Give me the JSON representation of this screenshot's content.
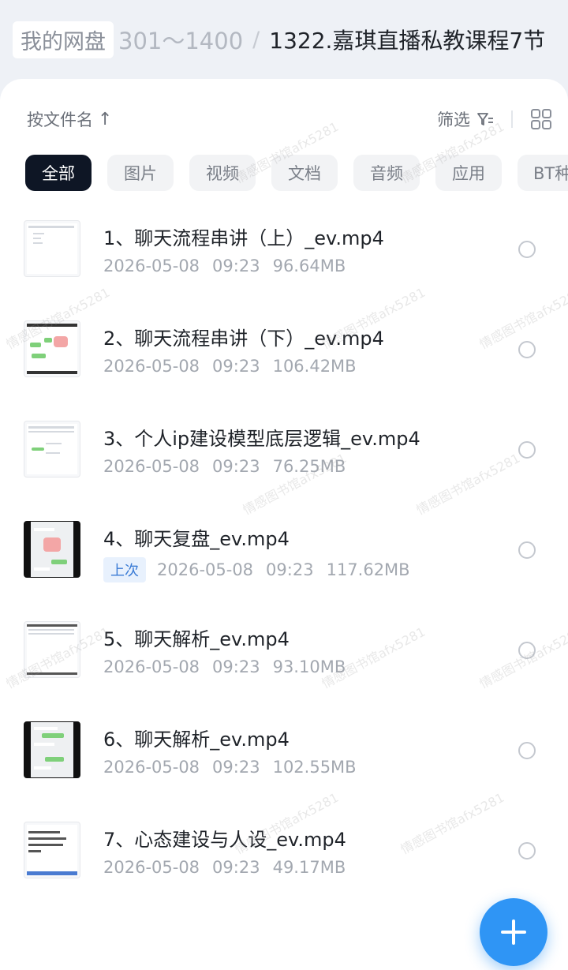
{
  "breadcrumb": {
    "root": "我的网盘",
    "parent": "301～1400",
    "separator": "/",
    "current": "1322.嘉琪直播私教课程7节"
  },
  "toolbar": {
    "sort_label": "按文件名",
    "sort_arrow": "↑",
    "filter_label": "筛选",
    "filter_icon": "filter-icon",
    "view_icon": "grid-view-icon"
  },
  "categories": [
    "全部",
    "图片",
    "视频",
    "文档",
    "音频",
    "应用",
    "BT种子"
  ],
  "active_category": "全部",
  "files": [
    {
      "name": "1、聊天流程串讲（上）_ev.mp4",
      "date": "2026-05-08",
      "time": "09:23",
      "size": "96.64MB",
      "badge": ""
    },
    {
      "name": "2、聊天流程串讲（下）_ev.mp4",
      "date": "2026-05-08",
      "time": "09:23",
      "size": "106.42MB",
      "badge": ""
    },
    {
      "name": "3、个人ip建设模型底层逻辑_ev.mp4",
      "date": "2026-05-08",
      "time": "09:23",
      "size": "76.25MB",
      "badge": ""
    },
    {
      "name": "4、聊天复盘_ev.mp4",
      "date": "2026-05-08",
      "time": "09:23",
      "size": "117.62MB",
      "badge": "上次"
    },
    {
      "name": "5、聊天解析_ev.mp4",
      "date": "2026-05-08",
      "time": "09:23",
      "size": "93.10MB",
      "badge": ""
    },
    {
      "name": "6、聊天解析_ev.mp4",
      "date": "2026-05-08",
      "time": "09:23",
      "size": "102.55MB",
      "badge": ""
    },
    {
      "name": "7、心态建设与人设_ev.mp4",
      "date": "2026-05-08",
      "time": "09:23",
      "size": "49.17MB",
      "badge": ""
    }
  ],
  "watermark_text": "情感图书馆afx5281",
  "colors": {
    "accent": "#2f95f5",
    "active_chip": "#0e1625",
    "badge_text": "#3a7bd5"
  }
}
